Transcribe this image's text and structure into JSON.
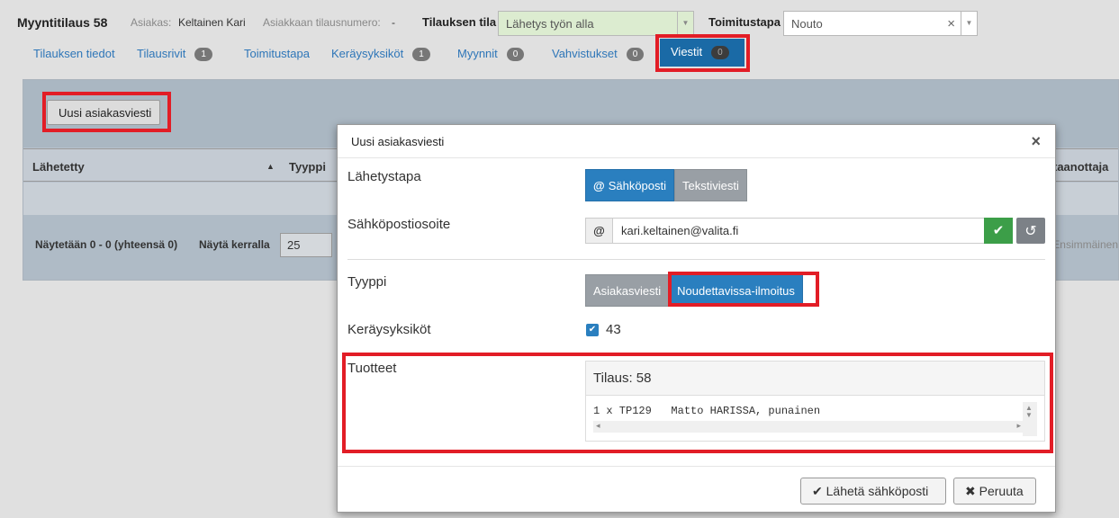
{
  "header": {
    "title": "Myyntitilaus 58",
    "customer_label": "Asiakas:",
    "customer_value": "Keltainen Kari",
    "order_number_label": "Asiakkaan tilausnumero:",
    "order_number_value": "-",
    "order_status_label": "Tilauksen tila",
    "order_status_value": "Lähetys työn alla",
    "delivery_label": "Toimitustapa",
    "delivery_value": "Nouto"
  },
  "tabs": [
    {
      "label": "Tilauksen tiedot"
    },
    {
      "label": "Tilausrivit",
      "badge": "1"
    },
    {
      "label": "Toimitustapa"
    },
    {
      "label": "Keräysyksiköt",
      "badge": "1"
    },
    {
      "label": "Myynnit",
      "badge": "0"
    },
    {
      "label": "Vahvistukset",
      "badge": "0"
    },
    {
      "label": "Viestit",
      "badge": "0",
      "active": true
    }
  ],
  "panel": {
    "new_message_button": "Uusi asiakasviesti",
    "columns": [
      "Lähetetty",
      "Tyyppi",
      "taanottaja"
    ],
    "showing": "Näytetään 0 - 0 (yhteensä 0)",
    "page_size_label": "Näytä kerralla",
    "page_size_value": "25",
    "first_label": "Ensimmäinen"
  },
  "modal": {
    "title": "Uusi asiakasviesti",
    "send_method_label": "Lähetystapa",
    "send_methods": [
      "Sähköposti",
      "Tekstiviesti"
    ],
    "selected_send_method": "Sähköposti",
    "email_label": "Sähköpostiosoite",
    "email_value": "kari.keltainen@valita.fi",
    "type_label": "Tyyppi",
    "types": [
      "Asiakasviesti",
      "Noudettavissa-ilmoitus"
    ],
    "selected_type": "Noudettavissa-ilmoitus",
    "collection_units_label": "Keräysyksiköt",
    "collection_unit": "43",
    "collection_unit_checked": true,
    "products_label": "Tuotteet",
    "products_order": "Tilaus: 58",
    "products_line": "1 x TP129   Matto HARISSA, punainen",
    "send_button": "Lähetä sähköposti",
    "cancel_button": "Peruuta"
  },
  "colors": {
    "primary": "#2a7fbf",
    "success": "#3c9e48",
    "highlight": "#e21d26",
    "active_tab": "#1a6aa6"
  }
}
